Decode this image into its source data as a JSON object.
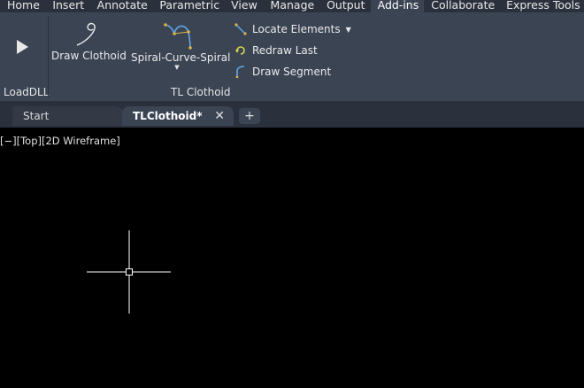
{
  "ribbon_tabs": [
    {
      "label": "Home"
    },
    {
      "label": "Insert"
    },
    {
      "label": "Annotate"
    },
    {
      "label": "Parametric"
    },
    {
      "label": "View"
    },
    {
      "label": "Manage"
    },
    {
      "label": "Output"
    },
    {
      "label": "Add-ins",
      "active": true
    },
    {
      "label": "Collaborate"
    },
    {
      "label": "Express Tools"
    }
  ],
  "panels": {
    "loaddll": {
      "title": "LoadDLL"
    },
    "tl_clothoid": {
      "title": "TL Clothoid",
      "draw_clothoid": "Draw Clothoid",
      "spiral_curve_spiral": "Spiral-Curve-Spiral",
      "locate_elements": "Locate Elements",
      "redraw_last": "Redraw Last",
      "draw_segment": "Draw Segment"
    }
  },
  "doc_tabs": {
    "start": "Start",
    "active": "TLClothoid*",
    "close_glyph": "✕",
    "new_tab_glyph": "+"
  },
  "viewport": {
    "label": "[−][Top][2D Wireframe]"
  },
  "colors": {
    "ribbon_bg": "#3b4453",
    "tabbar_bg": "#2b313c",
    "canvas_bg": "#000000"
  }
}
